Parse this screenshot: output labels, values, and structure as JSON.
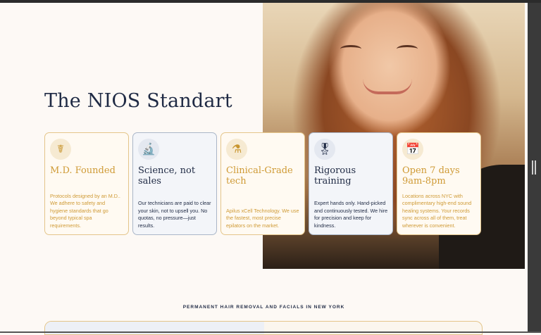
{
  "page_title": "The NIOS Standart",
  "cards": [
    {
      "icon": "caduceus-icon",
      "glyph": "☤",
      "title": "M.D. Founded",
      "desc": "Protocols designed by an M.D.. We adhere to safety and hygiene standards that go beyond typical spa requirements.",
      "style": "gold"
    },
    {
      "icon": "microscope-icon",
      "glyph": "🔬",
      "title": "Science, not sales",
      "desc": "Our technicians are paid to clear your skin, not to upsell you. No quotas, no pressure—just results.",
      "style": "navy"
    },
    {
      "icon": "beaker-icon",
      "glyph": "⚗",
      "title": "Clinical-Grade tech",
      "desc": "Apilus xCell Technology. We use the fastest, most precise epilators on the market.",
      "style": "gold"
    },
    {
      "icon": "award-ribbon-icon",
      "glyph": "🎖",
      "title": "Rigorous training",
      "desc": "Expert hands only. Hand-picked and continuously tested. We hire for precision and keep for kindness.",
      "style": "navy"
    },
    {
      "icon": "calendar-clock-icon",
      "glyph": "📅",
      "title": "Open 7 days 9am-8pm",
      "desc": "Locations across NYC with complimentary high-end sound healing systems. Your records sync across all of them, treat wherever is convenient.",
      "style": "gold"
    }
  ],
  "tagline": "PERMANENT HAIR REMOVAL AND FACIALS IN NEW YORK"
}
